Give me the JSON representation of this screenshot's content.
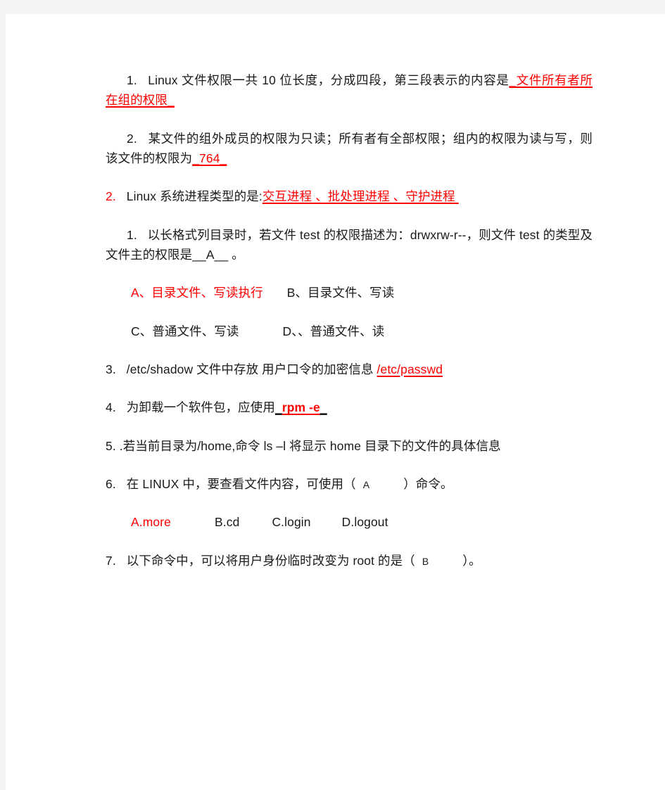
{
  "document": {
    "page_background": "#f4f4f4",
    "paper_color": "#ffffff",
    "answer_color": "#ff0000",
    "text_color": "#1a1a1a",
    "paragraphs": [
      {
        "id": "q1-fill",
        "number": "1.",
        "question": "Linux 文件权限一共 10 位长度，分成四段，第三段表示的内容是",
        "answer": "文件所有者所在组的权限"
      },
      {
        "id": "q2-fill",
        "number": "2.",
        "question": "某文件的组外成员的权限为只读；所有者有全部权限；组内的权限为读与写，则该文件的权限为",
        "answer": "764"
      },
      {
        "id": "q3-process",
        "number": "2.",
        "question": "Linux 系统进程类型的是:",
        "answer": "交互进程 、批处理进程 、守护进程"
      },
      {
        "id": "q4-choice-test",
        "number": "1.",
        "question_part_1": "以长格式列目录时，若文件 test 的权限描述为：drwxrw-r--，则文件 test 的类型及文件主的权限是",
        "blank": "__A__",
        "question_part_2": "。"
      },
      {
        "id": "q5-shadow",
        "number": "3.",
        "question": "/etc/shadow 文件中存放  用户口令的加密信息",
        "answer": "/etc/passwd"
      },
      {
        "id": "q6-rpm",
        "number": "4.",
        "question": "为卸载一个软件包，应使用",
        "answer_lead_underscore": "_",
        "answer": "rpm  -e",
        "answer_trail_underscore": "_"
      },
      {
        "id": "q7-ls",
        "number": "5.",
        "question": ".若当前目录为/home,命令 ls –l 将显示 home 目录下的文件的具体信息"
      },
      {
        "id": "q8-cat",
        "number": "6.",
        "question_part_1": "在 LINUX 中，要查看文件内容，可使用（",
        "answer_letter": "A",
        "question_part_2": "）命令。"
      },
      {
        "id": "q9-su",
        "number": "7.",
        "question_part_1": "以下命令中，可以将用户身份临时改变为 root 的是（",
        "answer_letter": "B",
        "question_part_2": "）。"
      }
    ],
    "choice_rows": [
      {
        "id": "choices-test-row-1",
        "options": [
          {
            "label": "A、目录文件、写读执行",
            "is_answer": true
          },
          {
            "label": "B、目录文件、写读",
            "is_answer": false
          }
        ]
      },
      {
        "id": "choices-test-row-2",
        "options": [
          {
            "label": "C、普通文件、写读",
            "is_answer": false
          },
          {
            "label": "D、、普通文件、读",
            "is_answer": false
          }
        ]
      },
      {
        "id": "choices-cat-row",
        "options": [
          {
            "label": "A.more",
            "is_answer": true
          },
          {
            "label": "B.cd",
            "is_answer": false
          },
          {
            "label": "C.login",
            "is_answer": false
          },
          {
            "label": "D.logout",
            "is_answer": false
          }
        ]
      }
    ]
  }
}
